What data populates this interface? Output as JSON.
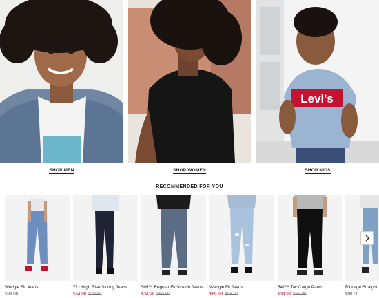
{
  "hero": [
    {
      "id": "men",
      "label": "SHOP MEN"
    },
    {
      "id": "women",
      "label": "SHOP WOMEN"
    },
    {
      "id": "kids",
      "label": "SHOP KIDS",
      "shirt_logo": "Levi's"
    }
  ],
  "recommended": {
    "title": "RECOMMENDED FOR YOU",
    "products": [
      {
        "name": "Wedgie Fit Jeans",
        "price": "$98.00",
        "sale_price": "",
        "was_price": ""
      },
      {
        "name": "721 High Rise Skinny Jeans",
        "price": "",
        "sale_price": "$54.98",
        "was_price": "$79.50"
      },
      {
        "name": "505™ Regular Fit Stretch Jeans",
        "price": "",
        "sale_price": "$34.98",
        "was_price": "$69.50"
      },
      {
        "name": "Wedgie Fit Jeans",
        "price": "",
        "sale_price": "$69.98",
        "was_price": "$98.00"
      },
      {
        "name": "541™ Tac Cargo Pants",
        "price": "",
        "sale_price": "$34.98",
        "was_price": "$69.00"
      },
      {
        "name": "Ribcage Straight",
        "price": "$98.00",
        "sale_price": "",
        "was_price": ""
      }
    ],
    "next_icon": "chevron-right-icon"
  },
  "colors": {
    "sale": "#c41230",
    "text": "#222222",
    "brand_red": "#c41230"
  }
}
